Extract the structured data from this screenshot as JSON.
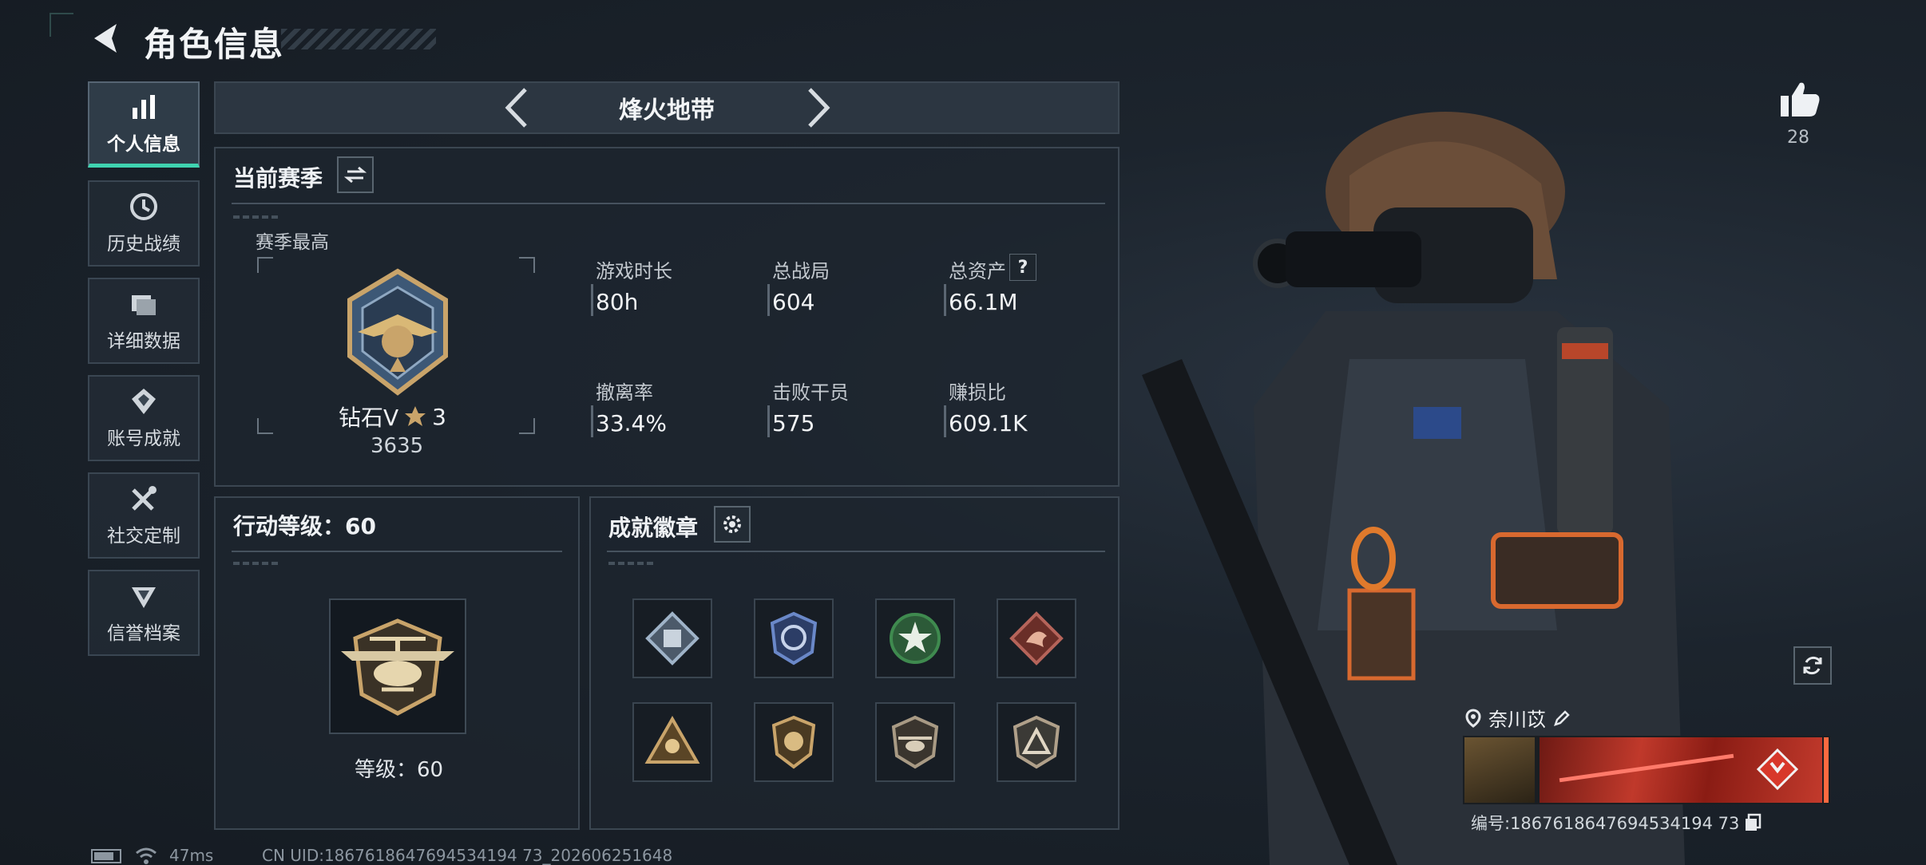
{
  "header": {
    "title": "角色信息"
  },
  "sidebar": {
    "items": [
      {
        "label": "个人信息",
        "icon": "bar-chart-icon",
        "active": true
      },
      {
        "label": "历史战绩",
        "icon": "history-icon"
      },
      {
        "label": "详细数据",
        "icon": "folder-icon"
      },
      {
        "label": "账号成就",
        "icon": "achievement-icon"
      },
      {
        "label": "社交定制",
        "icon": "tools-icon"
      },
      {
        "label": "信誉档案",
        "icon": "credit-icon"
      }
    ]
  },
  "mode": {
    "name": "烽火地带"
  },
  "season": {
    "title": "当前赛季",
    "best_label": "赛季最高",
    "rank_name": "钻石V",
    "rank_stars": "3",
    "rank_score": "3635",
    "stats": [
      {
        "label": "游戏时长",
        "value": "80h"
      },
      {
        "label": "总战局",
        "value": "604"
      },
      {
        "label": "总资产",
        "value": "66.1M",
        "help": "?"
      },
      {
        "label": "撤离率",
        "value": "33.4%"
      },
      {
        "label": "击败干员",
        "value": "575"
      },
      {
        "label": "赚损比",
        "value": "609.1K"
      }
    ]
  },
  "action_level": {
    "title": "行动等级：60",
    "level_text": "等级：60"
  },
  "achievements": {
    "title": "成就徽章",
    "badges": [
      {
        "icon": "shield-emblem-icon",
        "color": "#9fb3c8"
      },
      {
        "icon": "globe-emblem-icon",
        "color": "#6a88c8"
      },
      {
        "icon": "star-emblem-icon",
        "color": "#3f8a4f"
      },
      {
        "icon": "dragon-emblem-icon",
        "color": "#b5645a"
      },
      {
        "icon": "triangle-emblem-icon",
        "color": "#c9a46a"
      },
      {
        "icon": "helmet-emblem-icon",
        "color": "#c9a46a"
      },
      {
        "icon": "helicopter-emblem-icon",
        "color": "#a89a84"
      },
      {
        "icon": "peak-emblem-icon",
        "color": "#b0a08a"
      }
    ]
  },
  "likes": {
    "count": "28"
  },
  "player": {
    "name": "奈川苡",
    "id_text": "编号:1867618647694534194 73"
  },
  "footer": {
    "ping": "47ms",
    "uid": "CN UID:1867618647694534194 73_202606251648"
  },
  "colors": {
    "accent": "#3fd3b0",
    "gold": "#c9a46a",
    "card_red": "#c0392b"
  }
}
